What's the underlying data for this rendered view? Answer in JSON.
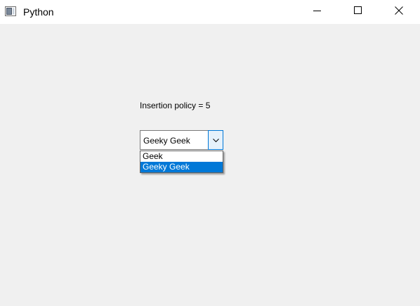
{
  "window": {
    "title": "Python",
    "icons": {
      "app": "python-app-icon",
      "minimize": "minimize-icon",
      "maximize": "maximize-icon",
      "close": "close-icon"
    }
  },
  "content": {
    "label": "Insertion policy = 5",
    "combo": {
      "current_value": "Geeky Geek",
      "arrow_icon": "chevron-down-icon",
      "expanded": true,
      "items": [
        {
          "label": "Geek",
          "selected": false
        },
        {
          "label": "Geeky Geek",
          "selected": true
        }
      ]
    }
  },
  "colors": {
    "background": "#f0f0f0",
    "titlebar": "#ffffff",
    "highlight": "#0078d7",
    "highlight_text": "#ffffff",
    "arrow_button": "#e5f1fb"
  }
}
